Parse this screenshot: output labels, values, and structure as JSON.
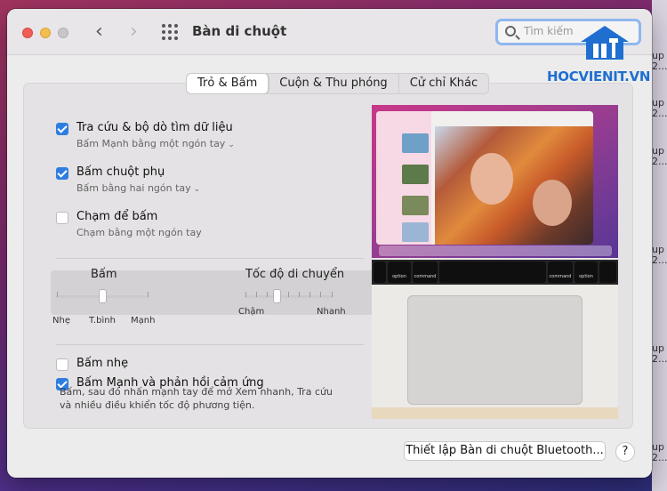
{
  "window": {
    "title": "Bàn di chuột",
    "search_placeholder": "Tìm kiếm",
    "nav_back": "‹",
    "nav_forward": "›"
  },
  "watermark": {
    "text": "HOCVIENIT.VN",
    "color": "#1f6fd1"
  },
  "tabs": [
    {
      "label": "Trỏ & Bấm",
      "active": true
    },
    {
      "label": "Cuộn & Thu phóng",
      "active": false
    },
    {
      "label": "Cử chỉ Khác",
      "active": false
    }
  ],
  "options": [
    {
      "title": "Tra cứu & bộ dò tìm dữ liệu",
      "subtitle": "Bấm Mạnh bằng một ngón tay",
      "checked": true,
      "has_dropdown": true
    },
    {
      "title": "Bấm chuột phụ",
      "subtitle": "Bấm bằng hai ngón tay",
      "checked": true,
      "has_dropdown": true
    },
    {
      "title": "Chạm để bấm",
      "subtitle": "Chạm bằng một ngón tay",
      "checked": false,
      "has_dropdown": false,
      "highlighted": true
    }
  ],
  "sliders": {
    "click": {
      "title": "Bấm",
      "labels": [
        "Nhẹ",
        "T.bình",
        "Mạnh"
      ],
      "value": "T.bình"
    },
    "tracking": {
      "title": "Tốc độ di chuyển",
      "labels": [
        "Chậm",
        "Nhanh"
      ],
      "value_fraction": 0.4
    }
  },
  "bottom_options": [
    {
      "title": "Bấm nhẹ",
      "checked": false
    },
    {
      "title": "Bấm Mạnh và phản hồi cảm ứng",
      "checked": true
    }
  ],
  "force_click_description": "Bấm, sau đó nhấn mạnh tay để mở Xem nhanh, Tra cứu và nhiều điều khiển tốc độ phương tiện.",
  "preview_keys": [
    "option",
    "command",
    "command",
    "option"
  ],
  "buttons": {
    "bluetooth_setup": "Thiết lập Bàn di chuột Bluetooth...",
    "help": "?"
  },
  "desktop_strip": [
    "up",
    "2...",
    "up",
    "2...",
    "up",
    "2...",
    "up",
    "2...",
    "up",
    "2...",
    "up",
    "2..."
  ],
  "colors": {
    "accent": "#2f7de1",
    "window_bg": "#ececec"
  }
}
